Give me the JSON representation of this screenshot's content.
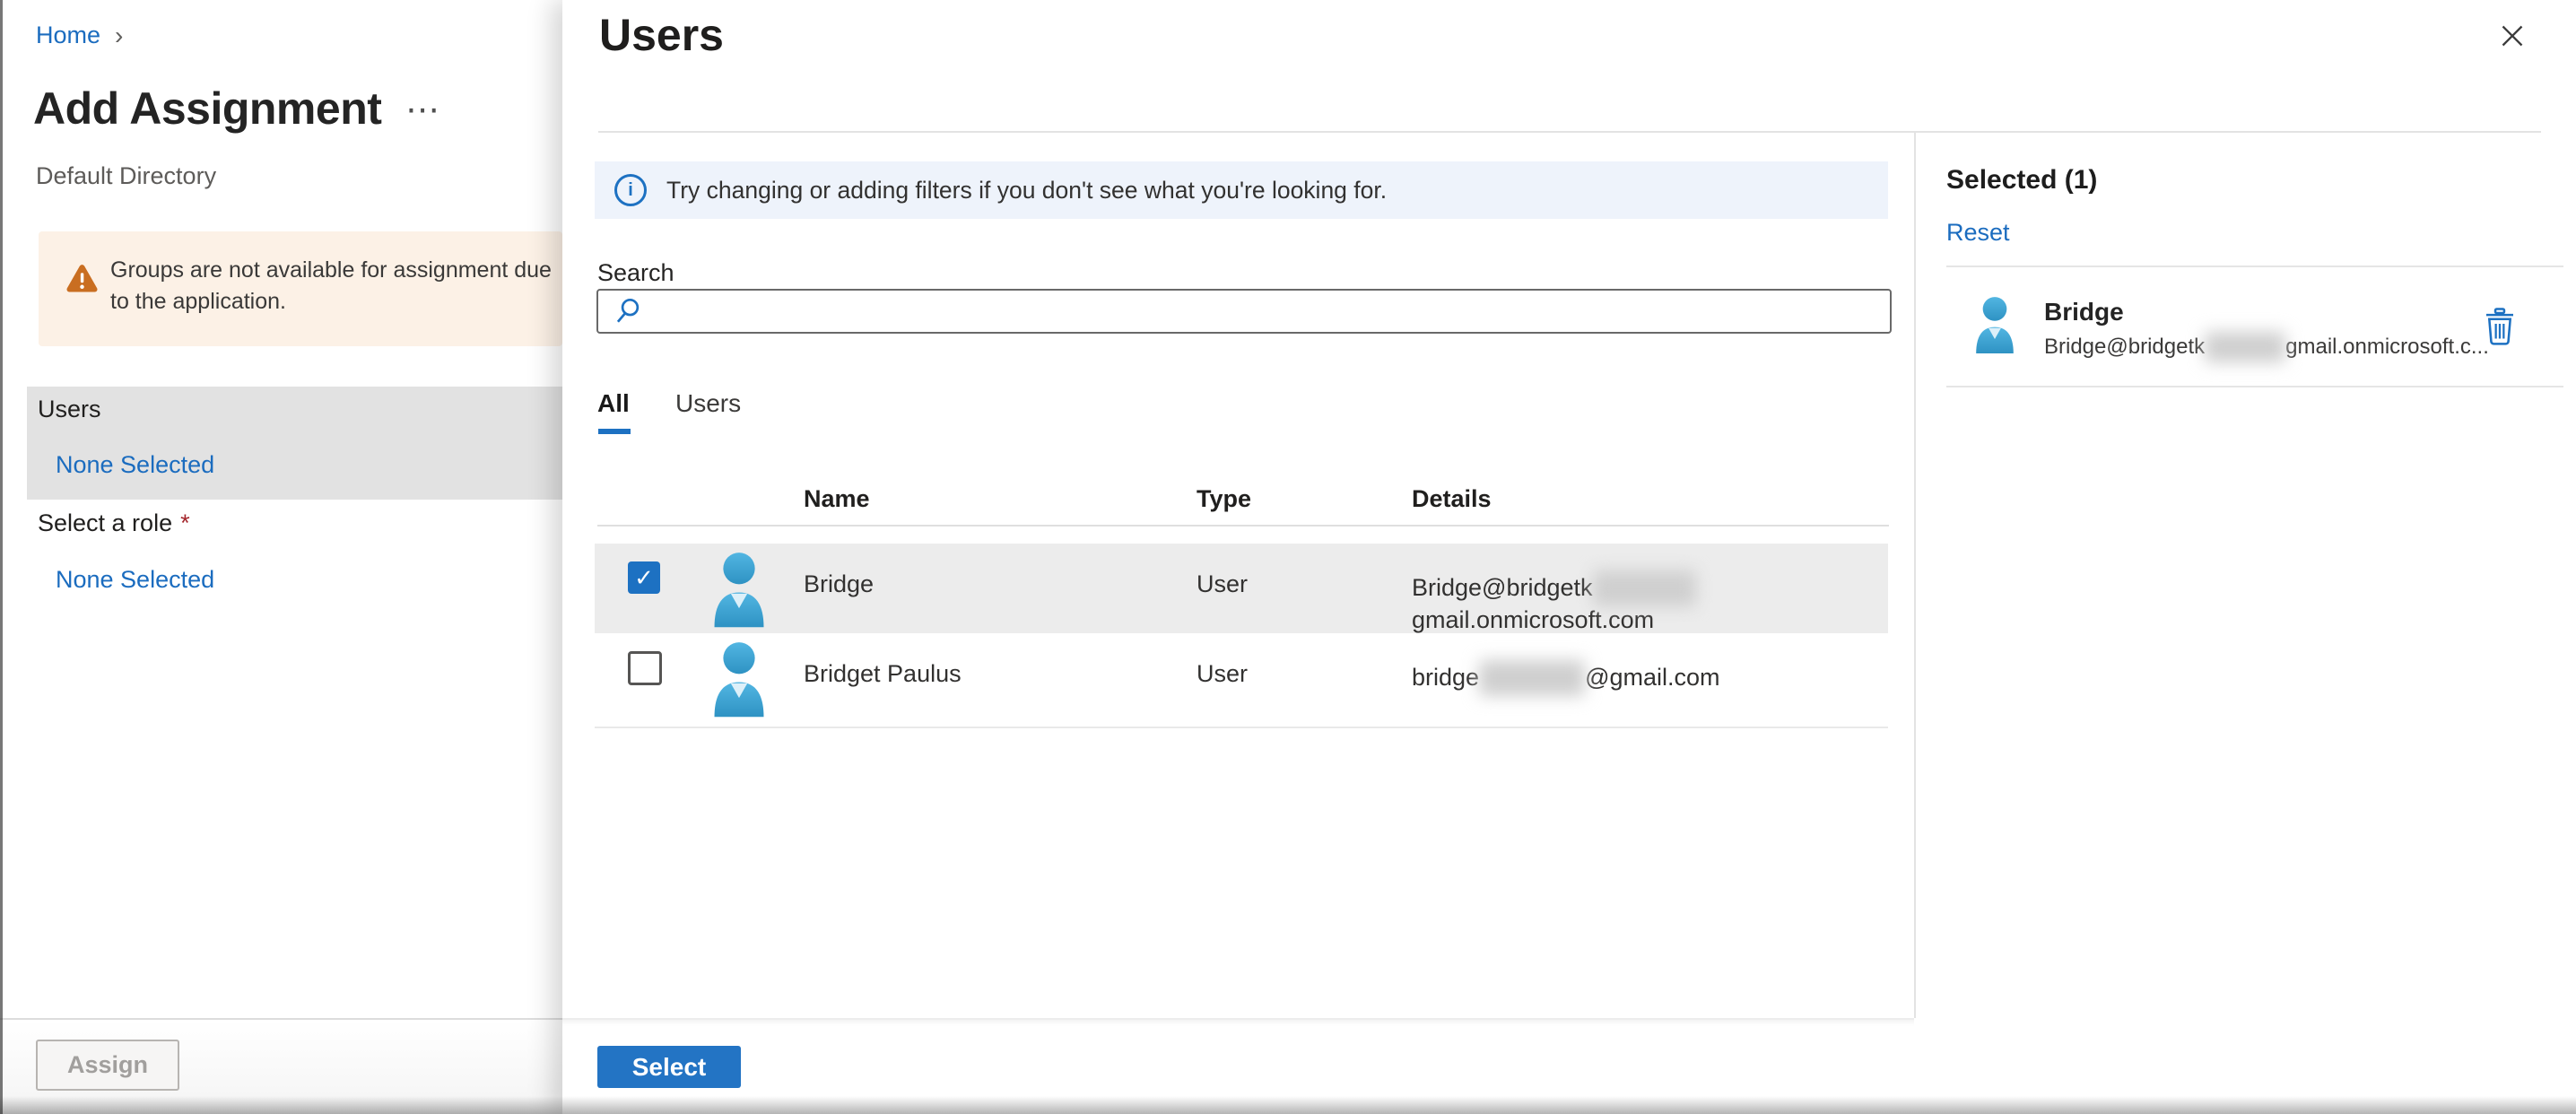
{
  "page": {
    "title": "Add Assignment",
    "subtitle": "Default Directory"
  },
  "breadcrumb": {
    "home": "Home",
    "chevron": "›"
  },
  "icons": {
    "more": "⋯",
    "check": "✓",
    "info": "i",
    "required": "*"
  },
  "warning_banner": {
    "text": "Groups are not available for assignment due to the application."
  },
  "left_nav": {
    "users_label": "Users",
    "users_value": "None Selected",
    "role_label": "Select a role",
    "role_value": "None Selected"
  },
  "footer": {
    "assign_label": "Assign",
    "select_label": "Select"
  },
  "panel": {
    "title": "Users",
    "info_banner": "Try changing or adding filters if you don't see what you're looking for.",
    "search_label": "Search",
    "search_value": "",
    "tabs": [
      {
        "label": "All",
        "active": true
      },
      {
        "label": "Users",
        "active": false
      }
    ],
    "table": {
      "columns": [
        "Name",
        "Type",
        "Details"
      ],
      "rows": [
        {
          "name": "Bridge",
          "type": "User",
          "email_prefix": "Bridge@bridgetk",
          "email_suffix": "gmail.onmicrosoft.com",
          "checked": true
        },
        {
          "name": "Bridget Paulus",
          "type": "User",
          "email_prefix": "bridge",
          "email_suffix": "@gmail.com",
          "checked": false
        }
      ]
    }
  },
  "selected_pane": {
    "header": "Selected (1)",
    "reset_label": "Reset",
    "item": {
      "name": "Bridge",
      "email_prefix": "Bridge@bridgetk",
      "email_suffix": "gmail.onmicrosoft.c..."
    }
  },
  "colors": {
    "accent": "#1d71c2",
    "link": "#1b6cbf",
    "primary_button": "#2374c4",
    "warning_orange": "#c96e21",
    "warning_bg": "#fcf1e6",
    "info_bg": "#eef3fb",
    "avatar_blue": "#3aa7d9",
    "selected_row_bg": "#ececec",
    "nav_selected_bg": "#e2e2e2"
  }
}
